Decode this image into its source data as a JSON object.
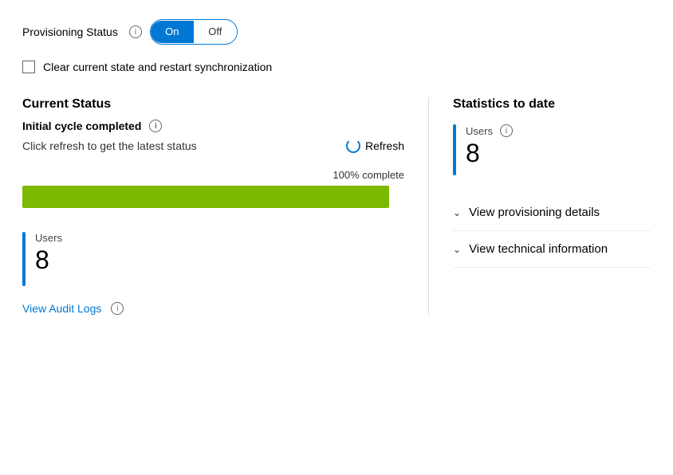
{
  "header": {
    "provisioning_status_label": "Provisioning Status",
    "toggle_on_label": "On",
    "toggle_off_label": "Off",
    "info_icon_label": "ⓘ",
    "checkbox_label": "Clear current state and restart synchronization"
  },
  "left": {
    "current_status_title": "Current Status",
    "cycle_label": "Initial cycle completed",
    "cycle_info_icon": "ⓘ",
    "refresh_hint": "Click refresh to get the latest status",
    "refresh_button_label": "Refresh",
    "progress_label": "100% complete",
    "progress_percent": 100
  },
  "bottom_users": {
    "label": "Users",
    "count": "8",
    "info_icon": "ⓘ",
    "audit_logs_link": "View Audit Logs",
    "audit_info_icon": "ⓘ"
  },
  "right": {
    "stats_title": "Statistics to date",
    "users_label": "Users",
    "users_info_icon": "ⓘ",
    "users_count": "8",
    "expandable_items": [
      {
        "label": "View provisioning details"
      },
      {
        "label": "View technical information"
      }
    ]
  },
  "colors": {
    "accent": "#0078d4",
    "progress_green": "#7cb900",
    "toggle_active_bg": "#0078d4"
  }
}
